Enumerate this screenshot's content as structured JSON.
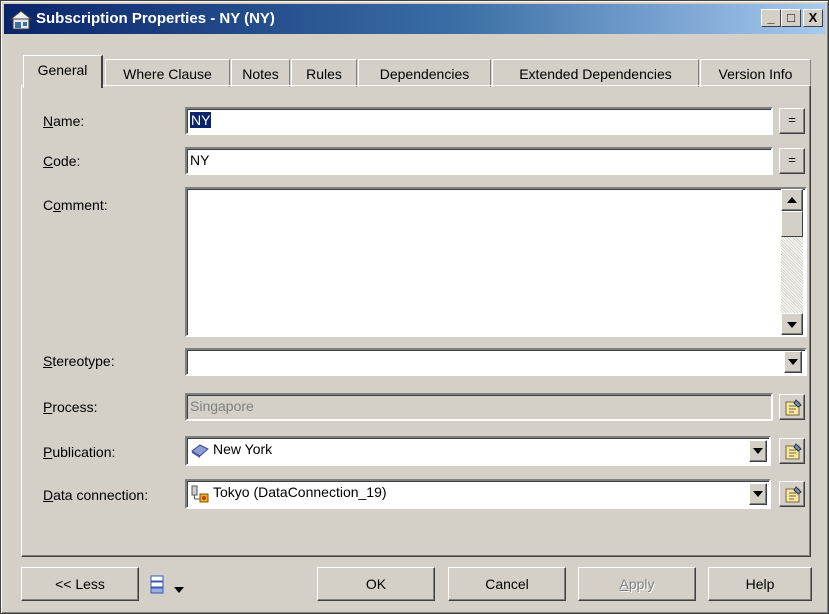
{
  "window": {
    "title": "Subscription Properties - NY (NY)",
    "minimize": "_",
    "maximize": "□",
    "close": "X"
  },
  "tabs": [
    "General",
    "Where Clause",
    "Notes",
    "Rules",
    "Dependencies",
    "Extended Dependencies",
    "Version Info"
  ],
  "form": {
    "name": {
      "label_u": "N",
      "label_rest": "ame:",
      "value": "NY",
      "btn": "="
    },
    "code": {
      "label_u": "C",
      "label_rest": "ode:",
      "value": "NY",
      "btn": "="
    },
    "comment": {
      "label_pre": "C",
      "label_u": "o",
      "label_rest": "mment:",
      "value": ""
    },
    "stereotype": {
      "label_u": "S",
      "label_rest": "tereotype:",
      "value": ""
    },
    "process": {
      "label_u": "P",
      "label_rest": "rocess:",
      "value": "Singapore"
    },
    "publication": {
      "label_u": "P",
      "label_rest": "ublication:",
      "value": "New York"
    },
    "data_connection": {
      "label_u": "D",
      "label_rest": "ata connection:",
      "value": "Tokyo (DataConnection_19)"
    }
  },
  "buttons": {
    "less": "<< Less",
    "ok": "OK",
    "cancel": "Cancel",
    "apply_u": "A",
    "apply_rest": "pply",
    "help": "Help"
  }
}
